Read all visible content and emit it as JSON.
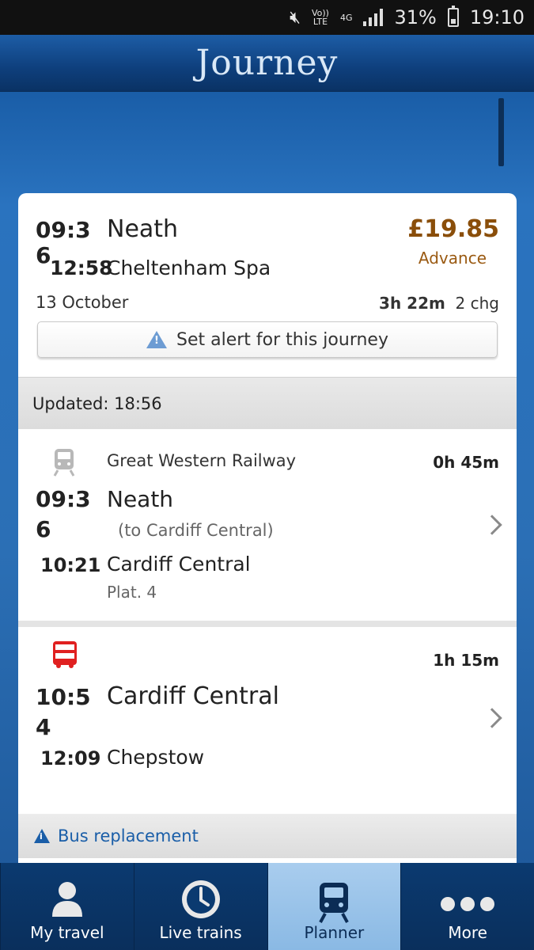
{
  "status_bar": {
    "volte": "Vo))",
    "lte": "LTE",
    "network": "4G",
    "battery": "31%",
    "time": "19:10"
  },
  "header": {
    "title": "Journey"
  },
  "summary": {
    "depart_time": "09:3",
    "depart_time_wrap": "6",
    "depart_station": "Neath",
    "arrive_time": "12:58",
    "arrive_station": "Cheltenham Spa",
    "price": "£19.85",
    "fare_type": "Advance",
    "date": "13 October",
    "duration": "3h 22m",
    "changes": "2 chg",
    "alert_button": "Set alert for this journey"
  },
  "updated": "Updated: 18:56",
  "legs": [
    {
      "mode": "train",
      "operator": "Great Western Railway",
      "duration": "0h 45m",
      "depart_time": "09:3",
      "depart_time_wrap": "6",
      "depart_station": "Neath",
      "destination_note": "(to Cardiff Central)",
      "arrive_time": "10:21",
      "arrive_station": "Cardiff Central",
      "platform": "Plat. 4"
    },
    {
      "mode": "bus",
      "operator": "",
      "duration": "1h 15m",
      "depart_time": "10:5",
      "depart_time_wrap": "4",
      "depart_station": "Cardiff Central",
      "arrive_time": "12:09",
      "arrive_station": "Chepstow"
    }
  ],
  "bus_notice": "Bus replacement",
  "nav": [
    {
      "label": "My travel",
      "icon": "person-icon",
      "active": false
    },
    {
      "label": "Live trains",
      "icon": "clock-icon",
      "active": false
    },
    {
      "label": "Planner",
      "icon": "train-icon",
      "active": true
    },
    {
      "label": "More",
      "icon": "dots-icon",
      "active": false
    }
  ],
  "colors": {
    "header": "#0e3f7c",
    "price": "#8a4e0a",
    "bus_red": "#e02020",
    "link_blue": "#1a5ea8",
    "nav_active": "#a9cdee"
  }
}
